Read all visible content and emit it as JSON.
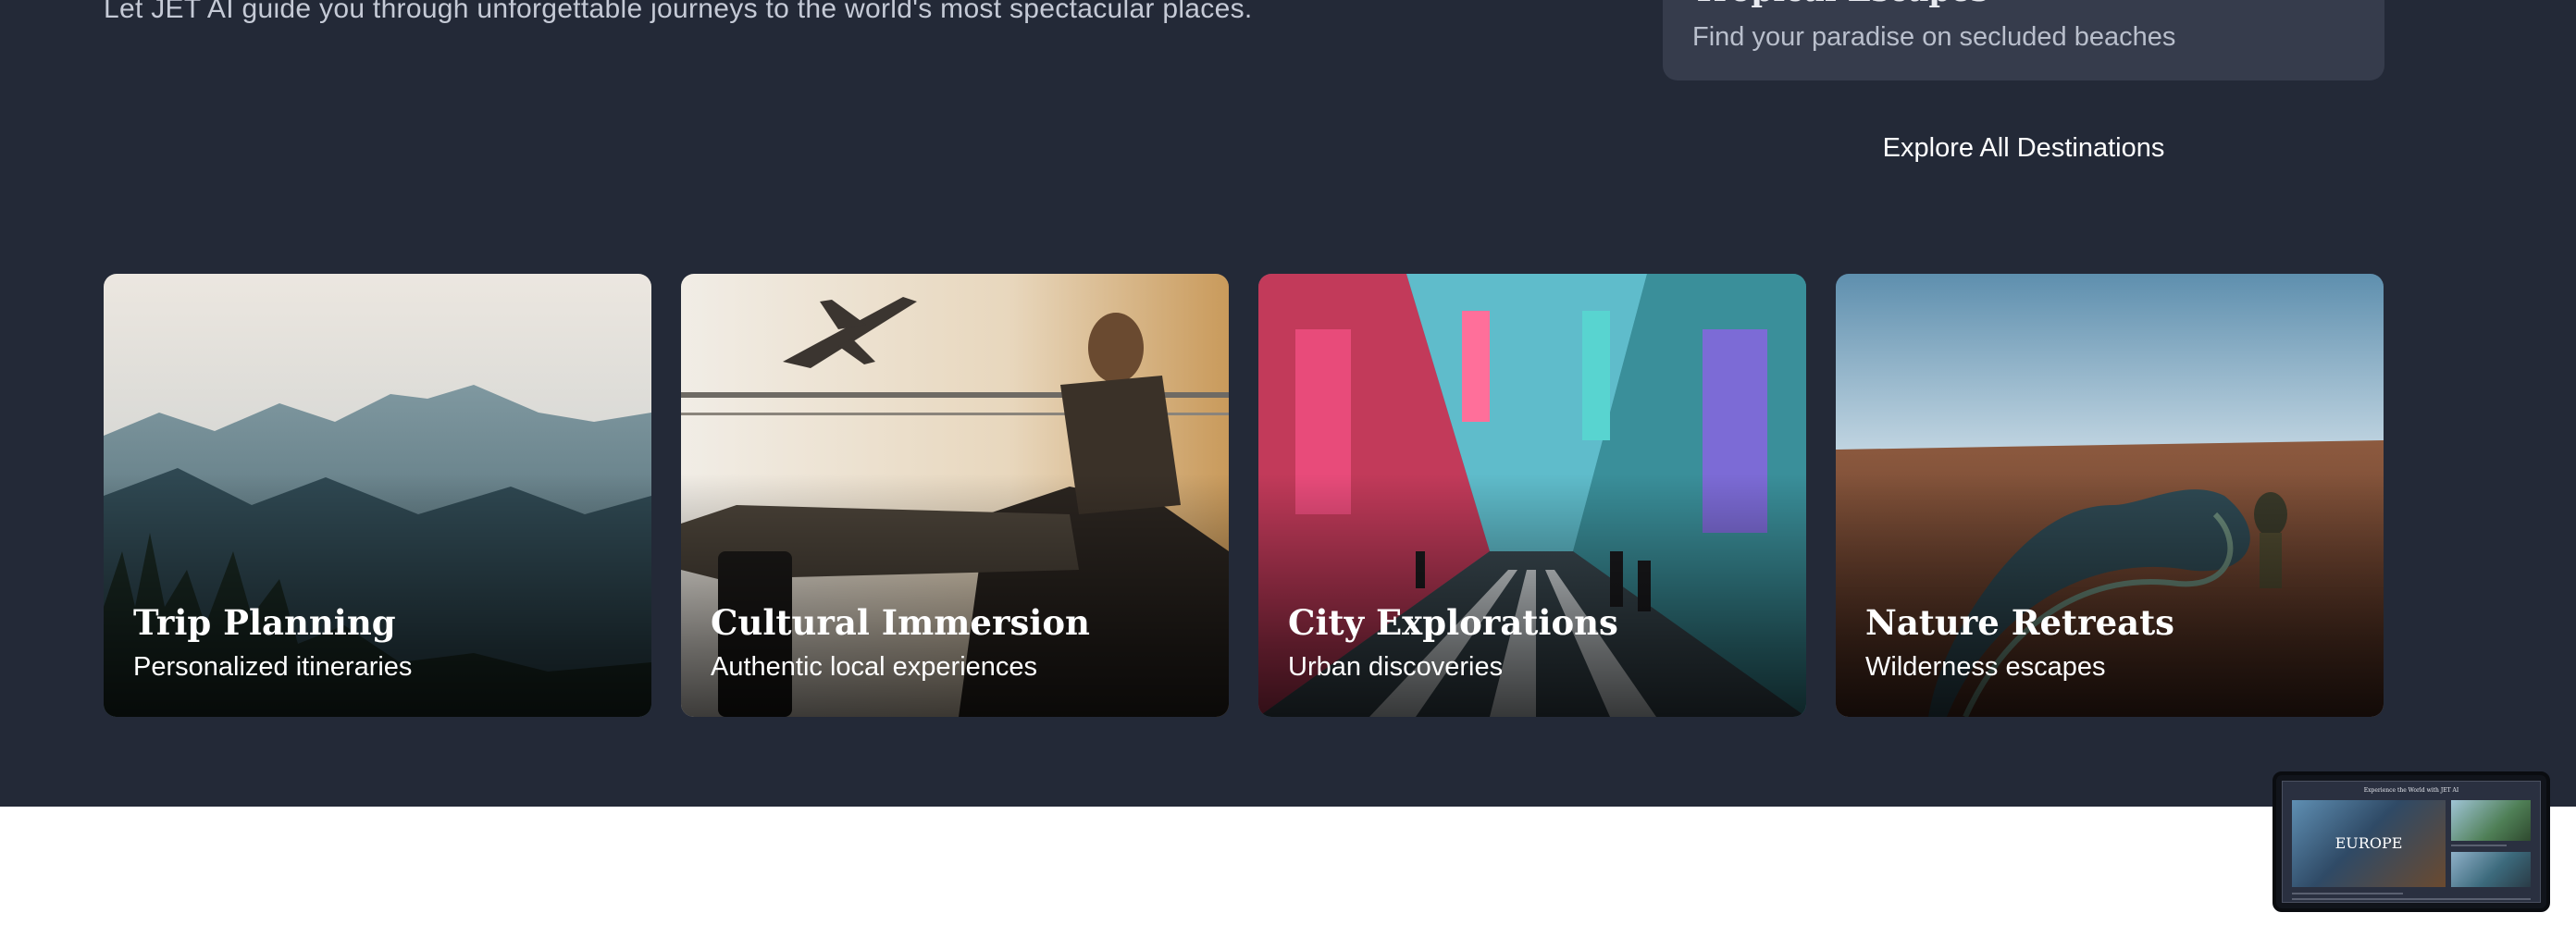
{
  "hero": {
    "tagline": "Let JET AI guide you through unforgettable journeys to the world's most spectacular places."
  },
  "destination_card": {
    "title": "Tropical Escapes",
    "subtitle": "Find your paradise on secluded beaches"
  },
  "explore_link": "Explore All Destinations",
  "cards": [
    {
      "title": "Trip Planning",
      "subtitle": "Personalized itineraries"
    },
    {
      "title": "Cultural Immersion",
      "subtitle": "Authentic local experiences"
    },
    {
      "title": "City Explorations",
      "subtitle": "Urban discoveries"
    },
    {
      "title": "Nature Retreats",
      "subtitle": "Wilderness escapes"
    }
  ],
  "preview": {
    "title": "Experience the World with JET AI",
    "hero_text": "EUROPE"
  },
  "colors": {
    "section_background": "#232937",
    "card_background": "#363c4c",
    "page_background": "#ffffff"
  }
}
